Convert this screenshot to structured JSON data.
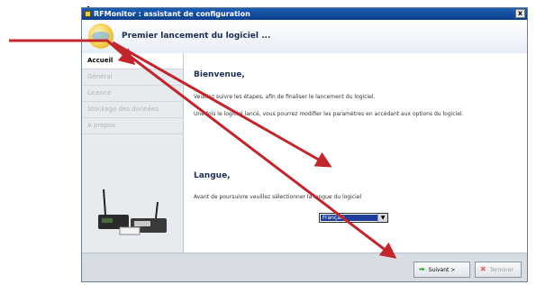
{
  "doc_fragment": "ion",
  "window": {
    "title": "RFMonitor : assistant de configuration",
    "close_label": "x"
  },
  "header": {
    "title": "Premier lancement du logiciel ..."
  },
  "sidebar": {
    "items": [
      {
        "label": "Accueil",
        "active": true
      },
      {
        "label": "Général",
        "active": false
      },
      {
        "label": "Licence",
        "active": false
      },
      {
        "label": "Stockage des données",
        "active": false
      },
      {
        "label": "A propos",
        "active": false
      }
    ]
  },
  "content": {
    "welcome_title": "Bienvenue,",
    "welcome_line1": "Veuillez suivre les étapes, afin de finaliser le lancement du logiciel.",
    "welcome_line2": "Une fois le logiciel lancé, vous pourrez modifier les paramètres en accédant aux options du logiciel.",
    "language_title": "Langue,",
    "language_line": "Avant de poursuivre veuillez sélectionner la langue du logiciel",
    "language_value": "Français"
  },
  "footer": {
    "next_label": "Suivant >",
    "finish_label": "Terminer"
  },
  "colors": {
    "annotation_arrow": "#c0262c",
    "title_bar": "#0b3f8a"
  }
}
